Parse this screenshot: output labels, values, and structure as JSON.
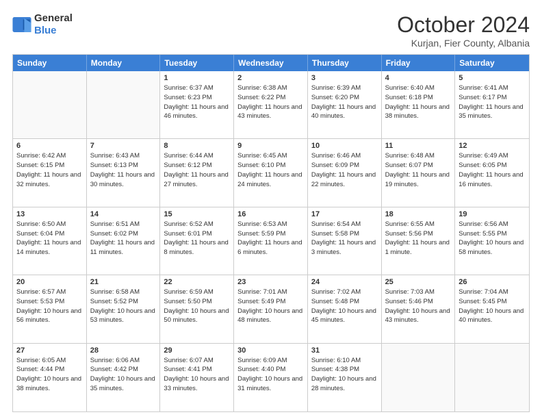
{
  "header": {
    "logo_general": "General",
    "logo_blue": "Blue",
    "title": "October 2024",
    "location": "Kurjan, Fier County, Albania"
  },
  "calendar": {
    "weekdays": [
      "Sunday",
      "Monday",
      "Tuesday",
      "Wednesday",
      "Thursday",
      "Friday",
      "Saturday"
    ],
    "weeks": [
      [
        {
          "day": "",
          "empty": true
        },
        {
          "day": "",
          "empty": true
        },
        {
          "day": "1",
          "sunrise": "6:37 AM",
          "sunset": "6:23 PM",
          "daylight": "11 hours and 46 minutes."
        },
        {
          "day": "2",
          "sunrise": "6:38 AM",
          "sunset": "6:22 PM",
          "daylight": "11 hours and 43 minutes."
        },
        {
          "day": "3",
          "sunrise": "6:39 AM",
          "sunset": "6:20 PM",
          "daylight": "11 hours and 40 minutes."
        },
        {
          "day": "4",
          "sunrise": "6:40 AM",
          "sunset": "6:18 PM",
          "daylight": "11 hours and 38 minutes."
        },
        {
          "day": "5",
          "sunrise": "6:41 AM",
          "sunset": "6:17 PM",
          "daylight": "11 hours and 35 minutes."
        }
      ],
      [
        {
          "day": "6",
          "sunrise": "6:42 AM",
          "sunset": "6:15 PM",
          "daylight": "11 hours and 32 minutes."
        },
        {
          "day": "7",
          "sunrise": "6:43 AM",
          "sunset": "6:13 PM",
          "daylight": "11 hours and 30 minutes."
        },
        {
          "day": "8",
          "sunrise": "6:44 AM",
          "sunset": "6:12 PM",
          "daylight": "11 hours and 27 minutes."
        },
        {
          "day": "9",
          "sunrise": "6:45 AM",
          "sunset": "6:10 PM",
          "daylight": "11 hours and 24 minutes."
        },
        {
          "day": "10",
          "sunrise": "6:46 AM",
          "sunset": "6:09 PM",
          "daylight": "11 hours and 22 minutes."
        },
        {
          "day": "11",
          "sunrise": "6:48 AM",
          "sunset": "6:07 PM",
          "daylight": "11 hours and 19 minutes."
        },
        {
          "day": "12",
          "sunrise": "6:49 AM",
          "sunset": "6:05 PM",
          "daylight": "11 hours and 16 minutes."
        }
      ],
      [
        {
          "day": "13",
          "sunrise": "6:50 AM",
          "sunset": "6:04 PM",
          "daylight": "11 hours and 14 minutes."
        },
        {
          "day": "14",
          "sunrise": "6:51 AM",
          "sunset": "6:02 PM",
          "daylight": "11 hours and 11 minutes."
        },
        {
          "day": "15",
          "sunrise": "6:52 AM",
          "sunset": "6:01 PM",
          "daylight": "11 hours and 8 minutes."
        },
        {
          "day": "16",
          "sunrise": "6:53 AM",
          "sunset": "5:59 PM",
          "daylight": "11 hours and 6 minutes."
        },
        {
          "day": "17",
          "sunrise": "6:54 AM",
          "sunset": "5:58 PM",
          "daylight": "11 hours and 3 minutes."
        },
        {
          "day": "18",
          "sunrise": "6:55 AM",
          "sunset": "5:56 PM",
          "daylight": "11 hours and 1 minute."
        },
        {
          "day": "19",
          "sunrise": "6:56 AM",
          "sunset": "5:55 PM",
          "daylight": "10 hours and 58 minutes."
        }
      ],
      [
        {
          "day": "20",
          "sunrise": "6:57 AM",
          "sunset": "5:53 PM",
          "daylight": "10 hours and 56 minutes."
        },
        {
          "day": "21",
          "sunrise": "6:58 AM",
          "sunset": "5:52 PM",
          "daylight": "10 hours and 53 minutes."
        },
        {
          "day": "22",
          "sunrise": "6:59 AM",
          "sunset": "5:50 PM",
          "daylight": "10 hours and 50 minutes."
        },
        {
          "day": "23",
          "sunrise": "7:01 AM",
          "sunset": "5:49 PM",
          "daylight": "10 hours and 48 minutes."
        },
        {
          "day": "24",
          "sunrise": "7:02 AM",
          "sunset": "5:48 PM",
          "daylight": "10 hours and 45 minutes."
        },
        {
          "day": "25",
          "sunrise": "7:03 AM",
          "sunset": "5:46 PM",
          "daylight": "10 hours and 43 minutes."
        },
        {
          "day": "26",
          "sunrise": "7:04 AM",
          "sunset": "5:45 PM",
          "daylight": "10 hours and 40 minutes."
        }
      ],
      [
        {
          "day": "27",
          "sunrise": "6:05 AM",
          "sunset": "4:44 PM",
          "daylight": "10 hours and 38 minutes."
        },
        {
          "day": "28",
          "sunrise": "6:06 AM",
          "sunset": "4:42 PM",
          "daylight": "10 hours and 35 minutes."
        },
        {
          "day": "29",
          "sunrise": "6:07 AM",
          "sunset": "4:41 PM",
          "daylight": "10 hours and 33 minutes."
        },
        {
          "day": "30",
          "sunrise": "6:09 AM",
          "sunset": "4:40 PM",
          "daylight": "10 hours and 31 minutes."
        },
        {
          "day": "31",
          "sunrise": "6:10 AM",
          "sunset": "4:38 PM",
          "daylight": "10 hours and 28 minutes."
        },
        {
          "day": "",
          "empty": true
        },
        {
          "day": "",
          "empty": true
        }
      ]
    ]
  }
}
